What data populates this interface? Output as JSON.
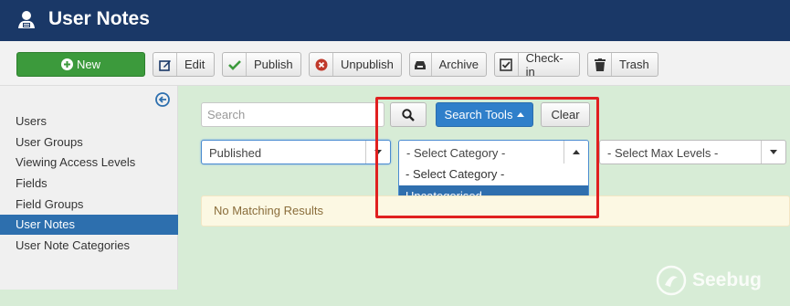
{
  "header": {
    "title": "User Notes",
    "logo_icon": "user-notes-icon"
  },
  "toolbar": {
    "new_label": "New",
    "edit_label": "Edit",
    "publish_label": "Publish",
    "unpublish_label": "Unpublish",
    "archive_label": "Archive",
    "checkin_label": "Check-in",
    "trash_label": "Trash"
  },
  "sidebar": {
    "items": [
      {
        "label": "Users",
        "active": false
      },
      {
        "label": "User Groups",
        "active": false
      },
      {
        "label": "Viewing Access Levels",
        "active": false
      },
      {
        "label": "Fields",
        "active": false
      },
      {
        "label": "Field Groups",
        "active": false
      },
      {
        "label": "User Notes",
        "active": true
      },
      {
        "label": "User Note Categories",
        "active": false
      }
    ]
  },
  "filters": {
    "search_placeholder": "Search",
    "search_tools_label": "Search Tools",
    "clear_label": "Clear",
    "status_value": "Published",
    "category_value": "- Select Category -",
    "category_options": [
      "- Select Category -",
      "Uncategorised"
    ],
    "category_selected_option": "Uncategorised",
    "max_levels_value": "- Select Max Levels -"
  },
  "message": {
    "text": "No Matching Results"
  },
  "watermark": {
    "text": "Seebug"
  },
  "colors": {
    "header_bg": "#1a3867",
    "new_button": "#3c9a3c",
    "search_tools": "#2f7fca",
    "active_sidebar": "#2d6fae",
    "highlight": "#e02020"
  }
}
